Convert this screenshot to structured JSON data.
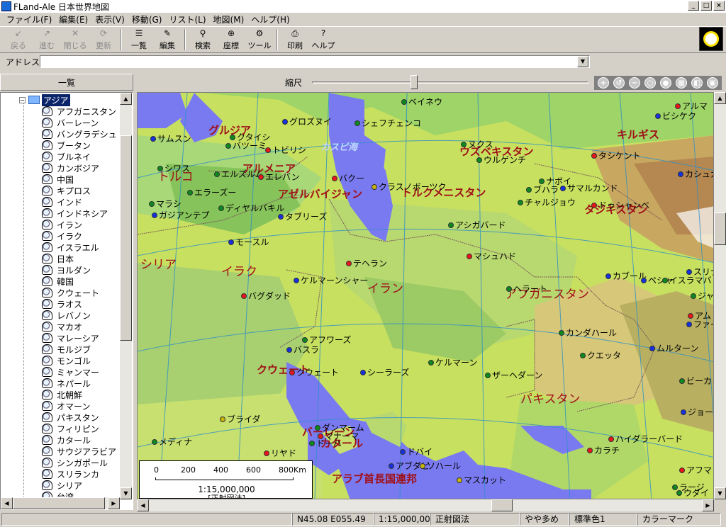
{
  "window": {
    "title": "FLand-Ale 日本世界地図"
  },
  "menu": [
    "ファイル(F)",
    "編集(E)",
    "表示(V)",
    "移動(G)",
    "リスト(L)",
    "地図(M)",
    "ヘルプ(H)"
  ],
  "toolbar": [
    {
      "label": "戻る",
      "icon": "back-arrow-icon",
      "enabled": false
    },
    {
      "label": "進む",
      "icon": "forward-arrow-icon",
      "enabled": false
    },
    {
      "label": "閉じる",
      "icon": "close-x-icon",
      "enabled": false
    },
    {
      "label": "更新",
      "icon": "refresh-icon",
      "enabled": false
    },
    {
      "label": "一覧",
      "icon": "list-tree-icon",
      "enabled": true
    },
    {
      "label": "編集",
      "icon": "pencil-icon",
      "enabled": true
    },
    {
      "label": "検索",
      "icon": "magnifier-icon",
      "enabled": true
    },
    {
      "label": "座標",
      "icon": "crosshair-icon",
      "enabled": true
    },
    {
      "label": "ツール",
      "icon": "tool-icon",
      "enabled": true
    },
    {
      "label": "印刷",
      "icon": "printer-icon",
      "enabled": true
    },
    {
      "label": "ヘルプ",
      "icon": "help-question-icon",
      "enabled": true
    }
  ],
  "address": {
    "label": "アドレス",
    "value": ""
  },
  "list": {
    "header": "一覧",
    "root": "アジア",
    "items": [
      "アフガニスタン",
      "バーレーン",
      "バングラデシュ",
      "ブータン",
      "ブルネイ",
      "カンボジア",
      "中国",
      "キプロス",
      "インド",
      "インドネシア",
      "イラン",
      "イラク",
      "イスラエル",
      "日本",
      "ヨルダン",
      "韓国",
      "クウェート",
      "ラオス",
      "レバノン",
      "マカオ",
      "マレーシア",
      "モルジブ",
      "モンゴル",
      "ミャンマー",
      "ネパール",
      "北朝鮮",
      "オマーン",
      "パキスタン",
      "フィリピン",
      "カタール",
      "サウジアラビア",
      "シンガポール",
      "スリランカ",
      "シリア",
      "台湾"
    ]
  },
  "scale": {
    "label": "縮尺",
    "slider_fraction": 0.37
  },
  "map": {
    "countries": [
      {
        "name": "グルジア"
      },
      {
        "name": "トルコ"
      },
      {
        "name": "アルメニア"
      },
      {
        "name": "アゼルバイジャン"
      },
      {
        "name": "ウズベキスタン"
      },
      {
        "name": "トルクメニスタン"
      },
      {
        "name": "キルギス"
      },
      {
        "name": "タジキスタン"
      },
      {
        "name": "シリア"
      },
      {
        "name": "イラク"
      },
      {
        "name": "イラン"
      },
      {
        "name": "アフガニスタン"
      },
      {
        "name": "クウェート"
      },
      {
        "name": "パキスタン"
      },
      {
        "name": "バーレーン"
      },
      {
        "name": "カタール"
      },
      {
        "name": "アラブ首長国連邦"
      }
    ],
    "sea": "カスピ海",
    "cities": [
      {
        "name": "ベイネウ",
        "c": "g"
      },
      {
        "name": "グロズヌイ",
        "c": "b"
      },
      {
        "name": "シェフチェンコ",
        "c": "g"
      },
      {
        "name": "サムスン",
        "c": "b"
      },
      {
        "name": "クタイシ",
        "c": "g"
      },
      {
        "name": "バツーミ",
        "c": "g"
      },
      {
        "name": "トビリシ",
        "c": "r"
      },
      {
        "name": "シワス",
        "c": "g"
      },
      {
        "name": "エルズルム",
        "c": "g"
      },
      {
        "name": "エレバン",
        "c": "r"
      },
      {
        "name": "バクー",
        "c": "r"
      },
      {
        "name": "クラスノボーツク",
        "c": "y"
      },
      {
        "name": "エラーズー",
        "c": "g"
      },
      {
        "name": "マラシ",
        "c": "g"
      },
      {
        "name": "ディヤルバキル",
        "c": "g"
      },
      {
        "name": "ガジアンテプ",
        "c": "b"
      },
      {
        "name": "タブリーズ",
        "c": "b"
      },
      {
        "name": "モースル",
        "c": "b"
      },
      {
        "name": "テヘラン",
        "c": "r"
      },
      {
        "name": "ケルマーンシャー",
        "c": "b"
      },
      {
        "name": "バグダッド",
        "c": "r"
      },
      {
        "name": "アシガバード",
        "c": "g"
      },
      {
        "name": "マシュハド",
        "c": "r"
      },
      {
        "name": "ヌクス",
        "c": "g"
      },
      {
        "name": "ウルゲンチ",
        "c": "g"
      },
      {
        "name": "ナボイ",
        "c": "g"
      },
      {
        "name": "ブハラ",
        "c": "g"
      },
      {
        "name": "サマルカンド",
        "c": "b"
      },
      {
        "name": "チャルジョウ",
        "c": "g"
      },
      {
        "name": "ドゥシャンベ",
        "c": "r"
      },
      {
        "name": "タシケント",
        "c": "r"
      },
      {
        "name": "ビシケク",
        "c": "b"
      },
      {
        "name": "カシュガ",
        "c": "b"
      },
      {
        "name": "アルマ",
        "c": "r"
      },
      {
        "name": "アフワーズ",
        "c": "g"
      },
      {
        "name": "バスラ",
        "c": "b"
      },
      {
        "name": "クウェート",
        "c": "r"
      },
      {
        "name": "シーラーズ",
        "c": "b"
      },
      {
        "name": "ケルマーン",
        "c": "g"
      },
      {
        "name": "ヘラート",
        "c": "g"
      },
      {
        "name": "カンダハール",
        "c": "g"
      },
      {
        "name": "クエッタ",
        "c": "g"
      },
      {
        "name": "カブール",
        "c": "b"
      },
      {
        "name": "ペシャ",
        "c": "b"
      },
      {
        "name": "イスラマバ",
        "c": "g"
      },
      {
        "name": "スリナ",
        "c": "b"
      },
      {
        "name": "ジャ",
        "c": "g"
      },
      {
        "name": "アム",
        "c": "r"
      },
      {
        "name": "ファイサラ",
        "c": "b"
      },
      {
        "name": "ムルターン",
        "c": "b"
      },
      {
        "name": "ザーヘダーン",
        "c": "g"
      },
      {
        "name": "ビーカ",
        "c": "g"
      },
      {
        "name": "ジョート",
        "c": "b"
      },
      {
        "name": "ブライダ",
        "c": "y"
      },
      {
        "name": "ダンマーム",
        "c": "g"
      },
      {
        "name": "マナーマ",
        "c": "r"
      },
      {
        "name": "ドーハ",
        "c": "g"
      },
      {
        "name": "ドバイ",
        "c": "b"
      },
      {
        "name": "アブダビ",
        "c": "b"
      },
      {
        "name": "ソハール",
        "c": "y"
      },
      {
        "name": "マスカット",
        "c": "y"
      },
      {
        "name": "メディナ",
        "c": "g"
      },
      {
        "name": "リヤド",
        "c": "r"
      },
      {
        "name": "ハイダラーバード",
        "c": "r"
      },
      {
        "name": "カラチ",
        "c": "r"
      },
      {
        "name": "アフマ",
        "c": "r"
      },
      {
        "name": "ラージ",
        "c": "g"
      },
      {
        "name": "ウダイ",
        "c": "g"
      }
    ],
    "scalebar": {
      "ticks": [
        "0",
        "200",
        "400",
        "600",
        "800Km"
      ],
      "ratio": "1:15,000,000",
      "projection": "[正射図法]"
    }
  },
  "status": {
    "coords": "N45.08 E055.49",
    "scale": "1:15,000,000",
    "projection": "正射図法",
    "density": "やや多め",
    "color": "標準色1",
    "mark": "カラーマーク"
  }
}
